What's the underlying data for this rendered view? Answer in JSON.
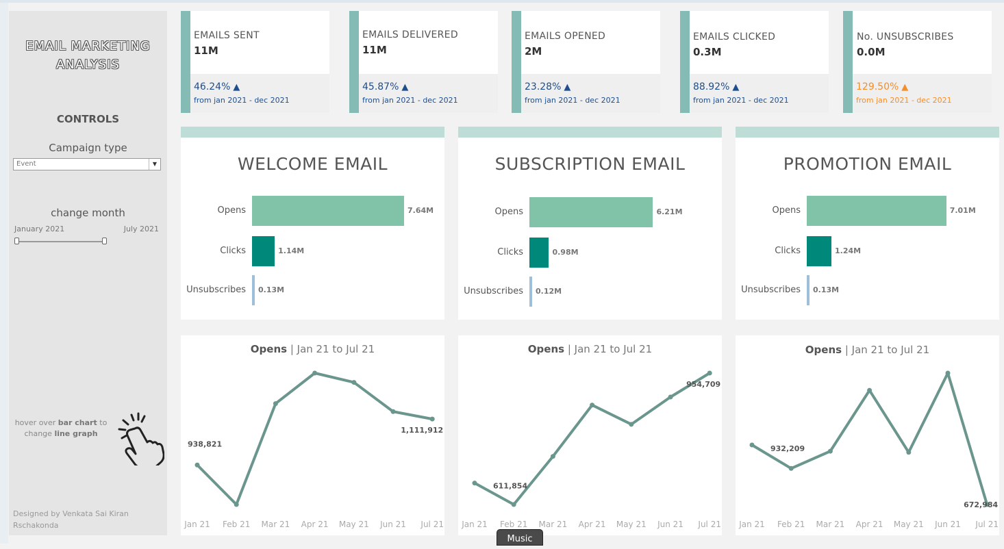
{
  "sidebar": {
    "title_line1": "EMAIL MARKETING",
    "title_line2": "ANALYSIS",
    "controls_title": "CONTROLS",
    "campaign_label": "Campaign type",
    "campaign_value": "Event",
    "month_label": "change month",
    "month_start": "January 2021",
    "month_end": "July 2021",
    "hint_part1": "hover over",
    "hint_bold1": "bar chart",
    "hint_part2": "to",
    "hint_part3": "change",
    "hint_bold2": "line graph",
    "credit_line1": "Designed by Venkata Sai Kiran",
    "credit_line2": "Rschakonda",
    "icon": "pointer-hand-icon"
  },
  "kpis": [
    {
      "label_light": "EMAILS ",
      "label_strong": "SENT",
      "value": "11M",
      "pct": "46.24%",
      "period": "from jan 2021 - dec 2021"
    },
    {
      "label_light": "EMAILS ",
      "label_strong": "DELIVERED",
      "value": "11M",
      "pct": "45.87%",
      "period": "from jan 2021 - dec 2021"
    },
    {
      "label_light": "EMAILS ",
      "label_strong": "OPENED",
      "value": "2M",
      "pct": "23.28%",
      "period": "from jan 2021 - dec 2021"
    },
    {
      "label_light": "EMAILS ",
      "label_strong": "CLICKED",
      "value": "0.3M",
      "pct": "88.92%",
      "period": "from jan 2021 - dec 2021"
    },
    {
      "label_light": "No. ",
      "label_strong": "UNSUBSCRIBES",
      "value": "0.0M",
      "pct": "129.50%",
      "period": "from jan 2021 - dec 2021"
    }
  ],
  "colors": {
    "accent": "#84bcb5",
    "opens": "#80c3a8",
    "clicks": "#00897b",
    "unsub": "#9ebfda",
    "line": "#6a968d",
    "kpi_pct": "#1f4e8c",
    "kpi_warn": "#f28e2b"
  },
  "panels": [
    {
      "title": "WELCOME EMAIL",
      "bars": [
        {
          "label": "Opens",
          "display": "7.64M"
        },
        {
          "label": "Clicks",
          "display": "1.14M"
        },
        {
          "label": "Unsubscribes",
          "display": "0.13M"
        }
      ],
      "line_title_bold": "Opens",
      "line_title_rest": " | Jan 21 to Jul 21",
      "first_label": "938,821",
      "last_label": "1,111,912"
    },
    {
      "title": "SUBSCRIPTION EMAIL",
      "bars": [
        {
          "label": "Opens",
          "display": "6.21M"
        },
        {
          "label": "Clicks",
          "display": "0.98M"
        },
        {
          "label": "Unsubscribes",
          "display": "0.12M"
        }
      ],
      "line_title_bold": "Opens",
      "line_title_rest": " | Jan 21 to Jul 21",
      "first_label": "611,854",
      "last_label": "954,709"
    },
    {
      "title": "PROMOTION EMAIL",
      "bars": [
        {
          "label": "Opens",
          "display": "7.01M"
        },
        {
          "label": "Clicks",
          "display": "1.24M"
        },
        {
          "label": "Unsubscribes",
          "display": "0.13M"
        }
      ],
      "line_title_bold": "Opens",
      "line_title_rest": " | Jan 21 to Jul 21",
      "first_label": "932,209",
      "last_label": "672,984"
    }
  ],
  "chart_data": [
    {
      "type": "bar",
      "title": "WELCOME EMAIL",
      "categories": [
        "Opens",
        "Clicks",
        "Unsubscribes"
      ],
      "values": [
        7.64,
        1.14,
        0.13
      ],
      "unit": "M"
    },
    {
      "type": "bar",
      "title": "SUBSCRIPTION EMAIL",
      "categories": [
        "Opens",
        "Clicks",
        "Unsubscribes"
      ],
      "values": [
        6.21,
        0.98,
        0.12
      ],
      "unit": "M"
    },
    {
      "type": "bar",
      "title": "PROMOTION EMAIL",
      "categories": [
        "Opens",
        "Clicks",
        "Unsubscribes"
      ],
      "values": [
        7.01,
        1.24,
        0.13
      ],
      "unit": "M"
    },
    {
      "type": "line",
      "title": "Opens | Jan 21 to Jul 21",
      "x": [
        "Jan 21",
        "Feb 21",
        "Mar 21",
        "Apr 21",
        "May 21",
        "Jun 21",
        "Jul 21"
      ],
      "values": [
        938821,
        790000,
        1170000,
        1285000,
        1250000,
        1140000,
        1111912
      ]
    },
    {
      "type": "line",
      "title": "Opens | Jan 21 to Jul 21",
      "x": [
        "Jan 21",
        "Feb 21",
        "Mar 21",
        "Apr 21",
        "May 21",
        "Jun 21",
        "Jul 21"
      ],
      "values": [
        611854,
        545000,
        695000,
        855000,
        795000,
        880000,
        954709
      ]
    },
    {
      "type": "line",
      "title": "Opens | Jan 21 to Jul 21",
      "x": [
        "Jan 21",
        "Feb 21",
        "Mar 21",
        "Apr 21",
        "May 21",
        "Jun 21",
        "Jul 21"
      ],
      "values": [
        932209,
        830000,
        905000,
        1170000,
        900000,
        1245000,
        672984
      ]
    }
  ],
  "tooltip": "Music"
}
